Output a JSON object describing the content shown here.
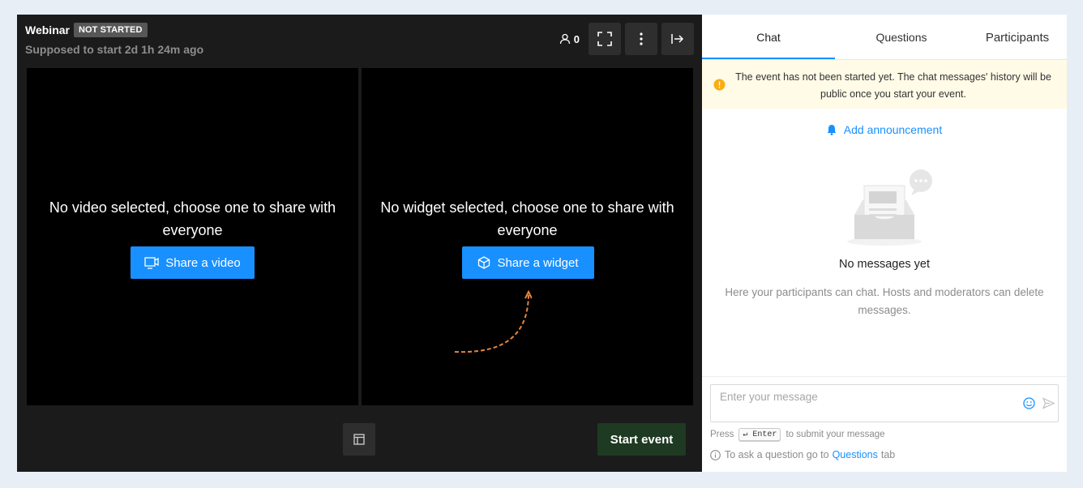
{
  "header": {
    "title": "Webinar",
    "status_badge": "NOT STARTED",
    "subtitle": "Supposed to start 2d 1h 24m ago",
    "participant_count": "0"
  },
  "video_pane": {
    "message": "No video selected, choose one to share with everyone",
    "button_label": "Share a video"
  },
  "widget_pane": {
    "message": "No widget selected, choose one to share with everyone",
    "button_label": "Share a widget"
  },
  "footer": {
    "start_label": "Start event"
  },
  "panel": {
    "tabs": [
      {
        "label": "Chat",
        "active": true
      },
      {
        "label": "Questions",
        "active": false
      },
      {
        "label": "Participants",
        "active": false
      }
    ],
    "notice": "The event has not been started yet. The chat messages' history will be public once you start your event.",
    "announcement_label": "Add announcement",
    "empty_title": "No messages yet",
    "empty_desc": "Here your participants can chat. Hosts and moderators can delete messages.",
    "composer_placeholder": "Enter your message",
    "hint_prefix": "Press",
    "hint_key": "↵ Enter",
    "hint_suffix": "to submit your message",
    "question_prefix": "To ask a question go to",
    "question_link": "Questions",
    "question_suffix": "tab"
  },
  "colors": {
    "accent": "#1890ff",
    "start_button": "#1e3a22",
    "badge": "#575757",
    "notice_bg": "#fffbe6",
    "warning": "#faad14",
    "dashed_arrow": "#e8843a"
  },
  "icons": {
    "count": "person-icon",
    "fullscreen": "fullscreen-icon",
    "more": "more-vertical-icon",
    "exit": "exit-icon",
    "video": "share-video-icon",
    "widget": "cube-icon",
    "layout": "layout-icon",
    "warning": "warning-icon",
    "bell": "bell-icon",
    "emoji": "emoji-icon",
    "send": "send-icon",
    "info": "info-icon"
  }
}
